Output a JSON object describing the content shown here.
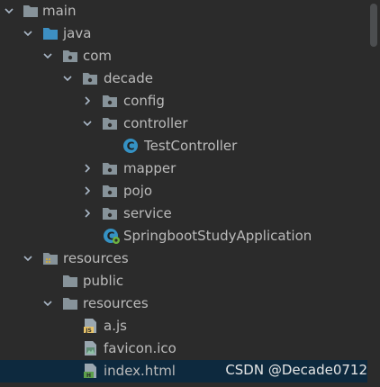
{
  "tree": {
    "items": [
      {
        "label": "main",
        "state": "expanded",
        "icon": "folder-icon"
      },
      {
        "label": "java",
        "state": "expanded",
        "icon": "source-folder-icon"
      },
      {
        "label": "com",
        "state": "expanded",
        "icon": "package-icon"
      },
      {
        "label": "decade",
        "state": "expanded",
        "icon": "package-icon"
      },
      {
        "label": "config",
        "state": "collapsed",
        "icon": "package-icon"
      },
      {
        "label": "controller",
        "state": "expanded",
        "icon": "package-icon"
      },
      {
        "label": "TestController",
        "state": "leaf",
        "icon": "java-class-icon"
      },
      {
        "label": "mapper",
        "state": "collapsed",
        "icon": "package-icon"
      },
      {
        "label": "pojo",
        "state": "collapsed",
        "icon": "package-icon"
      },
      {
        "label": "service",
        "state": "collapsed",
        "icon": "package-icon"
      },
      {
        "label": "SpringbootStudyApplication",
        "state": "leaf",
        "icon": "spring-boot-class-icon"
      },
      {
        "label": "resources",
        "state": "expanded",
        "icon": "resources-folder-icon"
      },
      {
        "label": "public",
        "state": "leaf",
        "icon": "folder-icon"
      },
      {
        "label": "resources",
        "state": "expanded",
        "icon": "folder-icon"
      },
      {
        "label": "a.js",
        "state": "leaf",
        "icon": "javascript-file-icon"
      },
      {
        "label": "favicon.ico",
        "state": "leaf",
        "icon": "image-file-icon"
      },
      {
        "label": "index.html",
        "state": "leaf",
        "icon": "html-file-icon"
      }
    ],
    "selected_label": "index.html"
  },
  "watermark": "CSDN @Decade0712",
  "colors": {
    "background": "#2b2b2b",
    "selection": "#0d293e",
    "text": "#bbbbbb",
    "folder": "#87939a",
    "source_folder": "#3d8fc2",
    "class_icon": "#3592c4",
    "spring_icon": "#6db33f"
  }
}
